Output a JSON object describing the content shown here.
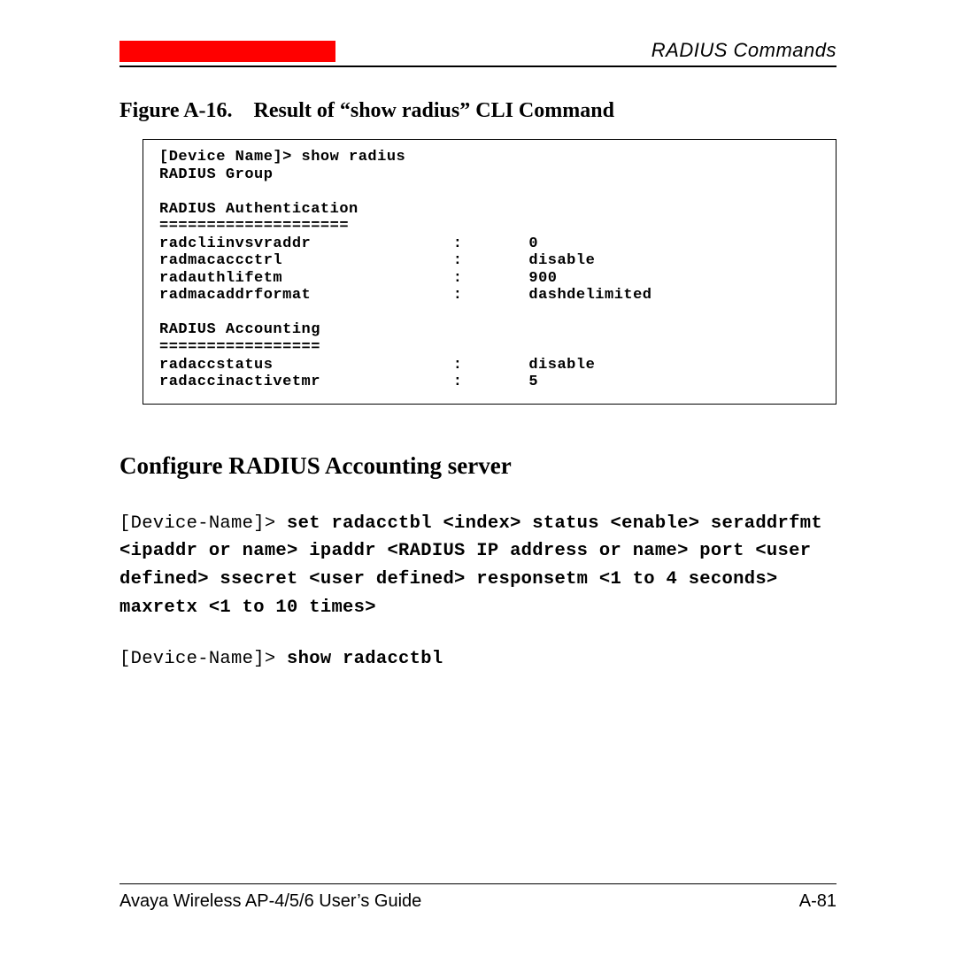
{
  "header": {
    "section_title": "RADIUS Commands"
  },
  "figure": {
    "caption": "Figure A-16. Result of “show radius” CLI Command"
  },
  "cli": {
    "prompt_line": "[Device Name]> show radius",
    "group_label": "RADIUS Group",
    "auth_header": "RADIUS Authentication",
    "auth_rule": "====================",
    "rows_auth": [
      {
        "key": "radcliinvsvraddr",
        "val": "0"
      },
      {
        "key": "radmacaccctrl",
        "val": "disable"
      },
      {
        "key": "radauthlifetm",
        "val": "900"
      },
      {
        "key": "radmacaddrformat",
        "val": "dashdelimited"
      }
    ],
    "acct_header": "RADIUS Accounting",
    "acct_rule": "=================",
    "rows_acct": [
      {
        "key": "radaccstatus",
        "val": "disable"
      },
      {
        "key": "radaccinactivetmr",
        "val": "5"
      }
    ]
  },
  "section": {
    "heading": "Configure RADIUS Accounting server"
  },
  "commands": {
    "prompt1": "[Device-Name]> ",
    "cmd1_bold": "set radacctbl <index> status <enable> seraddrfmt <ipaddr or name> ipaddr <RADIUS IP address or name> port <user defined> ssecret <user defined> responsetm <1 to 4 seconds> maxretx <1 to 10 times>",
    "prompt2": "[Device-Name]> ",
    "cmd2_bold": "show radacctbl"
  },
  "footer": {
    "left": "Avaya Wireless AP-4/5/6 User’s Guide",
    "right": "A-81"
  }
}
